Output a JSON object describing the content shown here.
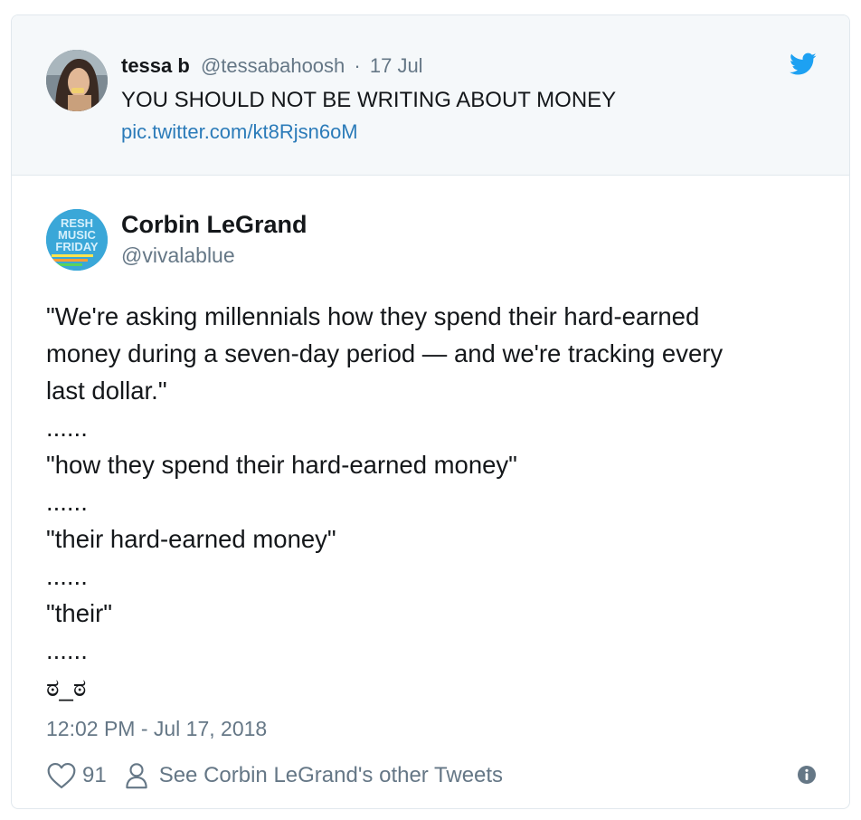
{
  "quoted_tweet": {
    "name": "tessa b",
    "handle": "@tessabahoosh",
    "separator": "·",
    "date": "17 Jul",
    "text": "YOU SHOULD NOT BE WRITING ABOUT MONEY",
    "link": "pic.twitter.com/kt8Rjsn6oM"
  },
  "tweet": {
    "name": "Corbin LeGrand",
    "handle": "@vivalablue",
    "avatar_text": [
      "RESH",
      "MUSIC",
      "FRIDAY"
    ],
    "lines": [
      "\"We're asking millennials how they spend their hard-earned",
      "money during a seven-day period — and we're tracking every",
      "last dollar.\"",
      "......",
      "\"how they spend their hard-earned money\"",
      "......",
      "\"their hard-earned money\"",
      "......",
      "\"their\"",
      "......",
      "ಠ_ಠ"
    ],
    "timestamp": "12:02 PM - Jul 17, 2018",
    "likes": "91",
    "profile_link": "See Corbin LeGrand's other Tweets"
  },
  "icons": {
    "bird": "twitter-bird-icon",
    "heart": "heart-icon",
    "person": "person-icon",
    "info": "info-icon"
  },
  "colors": {
    "brand_blue": "#1da1f2",
    "link": "#2b7bb9",
    "muted": "#657786",
    "quoted_bg": "#f5f8fa"
  }
}
